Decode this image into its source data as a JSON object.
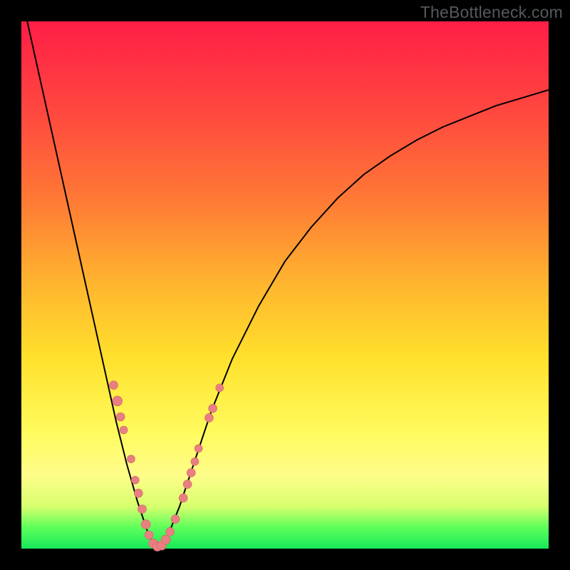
{
  "watermark": "TheBottleneck.com",
  "colors": {
    "curve_stroke": "#000000",
    "marker_fill": "#e87f81",
    "marker_stroke": "#d26668"
  },
  "chart_data": {
    "type": "line",
    "title": "",
    "xlabel": "",
    "ylabel": "",
    "xlim": [
      0,
      100
    ],
    "ylim": [
      0,
      100
    ],
    "series": [
      {
        "name": "bottleneck-curve",
        "x": [
          0,
          2,
          4,
          6,
          8,
          10,
          12,
          14,
          16,
          18,
          20,
          22,
          24,
          25,
          26,
          27,
          28,
          30,
          32,
          34,
          36,
          40,
          45,
          50,
          55,
          60,
          65,
          70,
          75,
          80,
          85,
          90,
          95,
          100
        ],
        "y": [
          105,
          96,
          87,
          78,
          69,
          60,
          51,
          42,
          33,
          24,
          16,
          9,
          3,
          1,
          0.3,
          1,
          3,
          8,
          14,
          20,
          26,
          36,
          46,
          54.5,
          61,
          66.5,
          71,
          74.5,
          77.5,
          80,
          82,
          84,
          85.5,
          87
        ]
      }
    ],
    "markers": [
      {
        "x": 17.5,
        "y": 31,
        "r": 6
      },
      {
        "x": 18.2,
        "y": 28,
        "r": 7
      },
      {
        "x": 18.8,
        "y": 25,
        "r": 6
      },
      {
        "x": 19.4,
        "y": 22.5,
        "r": 5.5
      },
      {
        "x": 20.8,
        "y": 17,
        "r": 5.5
      },
      {
        "x": 21.6,
        "y": 13,
        "r": 5.5
      },
      {
        "x": 22.2,
        "y": 10.5,
        "r": 6
      },
      {
        "x": 22.9,
        "y": 7.5,
        "r": 6
      },
      {
        "x": 23.6,
        "y": 4.6,
        "r": 6.5
      },
      {
        "x": 24.2,
        "y": 2.6,
        "r": 6
      },
      {
        "x": 25.0,
        "y": 1.0,
        "r": 6.5
      },
      {
        "x": 25.8,
        "y": 0.4,
        "r": 6.5
      },
      {
        "x": 26.6,
        "y": 0.6,
        "r": 6.5
      },
      {
        "x": 27.4,
        "y": 1.7,
        "r": 6.5
      },
      {
        "x": 28.2,
        "y": 3.2,
        "r": 6
      },
      {
        "x": 29.2,
        "y": 5.6,
        "r": 6
      },
      {
        "x": 30.7,
        "y": 9.6,
        "r": 6
      },
      {
        "x": 31.5,
        "y": 12.2,
        "r": 6
      },
      {
        "x": 32.2,
        "y": 14.4,
        "r": 6
      },
      {
        "x": 32.9,
        "y": 16.5,
        "r": 5.5
      },
      {
        "x": 33.6,
        "y": 19.0,
        "r": 5.5
      },
      {
        "x": 35.6,
        "y": 24.8,
        "r": 6
      },
      {
        "x": 36.3,
        "y": 26.6,
        "r": 6
      },
      {
        "x": 37.6,
        "y": 30.5,
        "r": 5.5
      }
    ]
  }
}
